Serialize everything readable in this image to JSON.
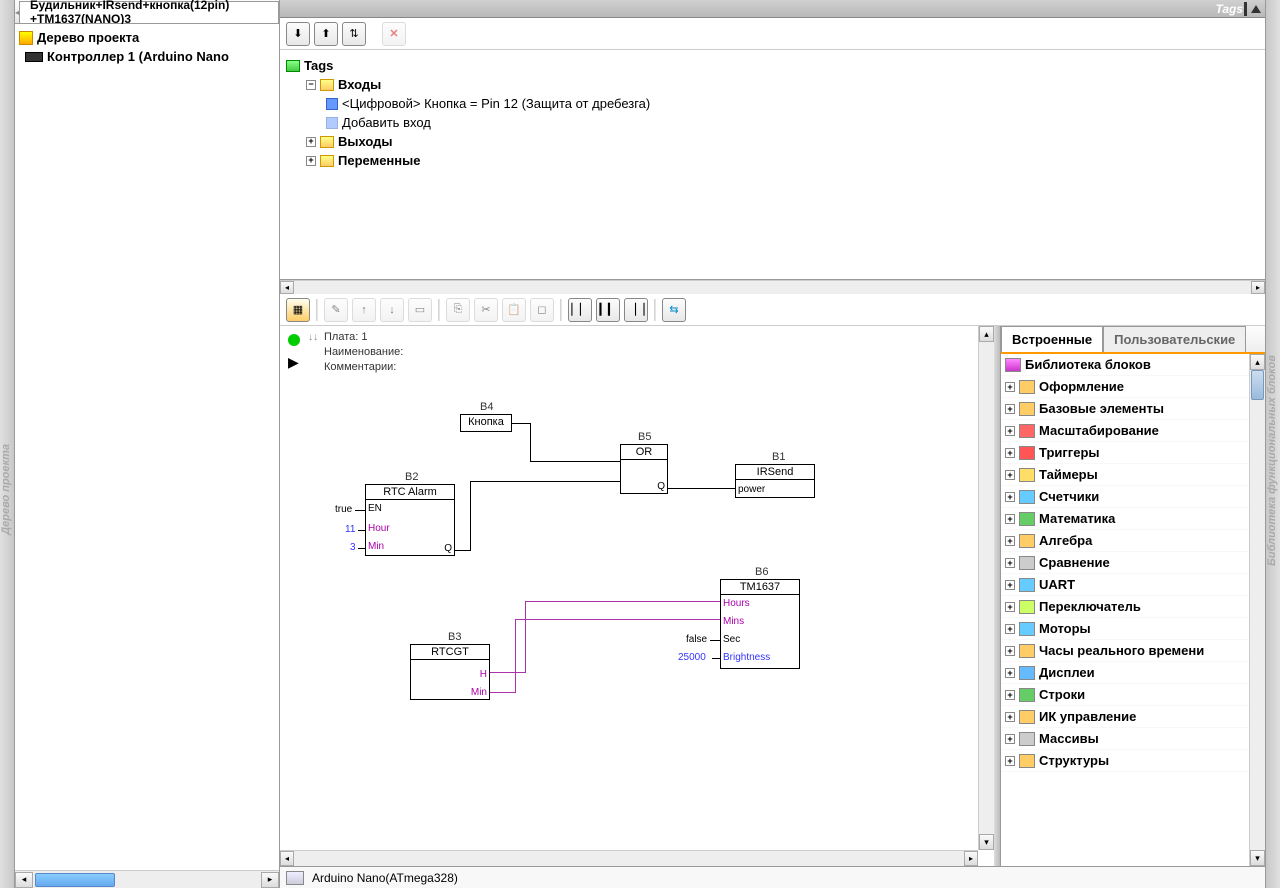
{
  "tab_title": "Будильник+IRsend+кнопка(12pin) +TM1637(NANO)3",
  "left_side_label": "Дерево проекта",
  "right_side_label": "Библиотека функциональных блоков",
  "project_tree": {
    "root": "Дерево проекта",
    "controller": "Контроллер 1 (Arduino Nano"
  },
  "tags_panel": {
    "title": "Tags",
    "root": "Tags",
    "inputs": "Входы",
    "input_item": "<Цифровой> Кнопка = Pin 12 (Защита от дребезга)",
    "add_input": "Добавить вход",
    "outputs": "Выходы",
    "variables": "Переменные"
  },
  "canvas": {
    "plate": "Плата: 1",
    "name_label": "Наименование:",
    "comment_label": "Комментарии:",
    "blocks": {
      "b1": {
        "id": "B1",
        "name": "IRSend",
        "port": "power"
      },
      "b2": {
        "id": "B2",
        "name": "RTC Alarm",
        "p_en": "EN",
        "p_hour": "Hour",
        "p_min": "Min",
        "p_q": "Q",
        "v_true": "true",
        "v_hour": "11",
        "v_min": "3"
      },
      "b3": {
        "id": "B3",
        "name": "RTCGT",
        "p_h": "H",
        "p_min": "Min"
      },
      "b4": {
        "id": "B4",
        "name": "Кнопка"
      },
      "b5": {
        "id": "B5",
        "name": "OR",
        "p_q": "Q"
      },
      "b6": {
        "id": "B6",
        "name": "TM1637",
        "p_hours": "Hours",
        "p_mins": "Mins",
        "p_sec": "Sec",
        "p_bright": "Brightness",
        "v_false": "false",
        "v_bright": "25000"
      }
    }
  },
  "library": {
    "tab_builtin": "Встроенные",
    "tab_user": "Пользовательские",
    "root": "Библиотека блоков",
    "items": [
      "Оформление",
      "Базовые элементы",
      "Масштабирование",
      "Триггеры",
      "Таймеры",
      "Счетчики",
      "Математика",
      "Алгебра",
      "Сравнение",
      "UART",
      "Переключатель",
      "Моторы",
      "Часы реального времени",
      "Дисплеи",
      "Строки",
      "ИК управление",
      "Массивы",
      "Структуры"
    ]
  },
  "lib_colors": [
    "#fc6",
    "#fc6",
    "#f66",
    "#f55",
    "#fd6",
    "#6cf",
    "#6c6",
    "#fc6",
    "#ccc",
    "#6cf",
    "#cf6",
    "#6cf",
    "#fc6",
    "#6bf",
    "#6c6",
    "#fc6",
    "#ccc",
    "#fc6"
  ],
  "status": "Arduino Nano(ATmega328)"
}
